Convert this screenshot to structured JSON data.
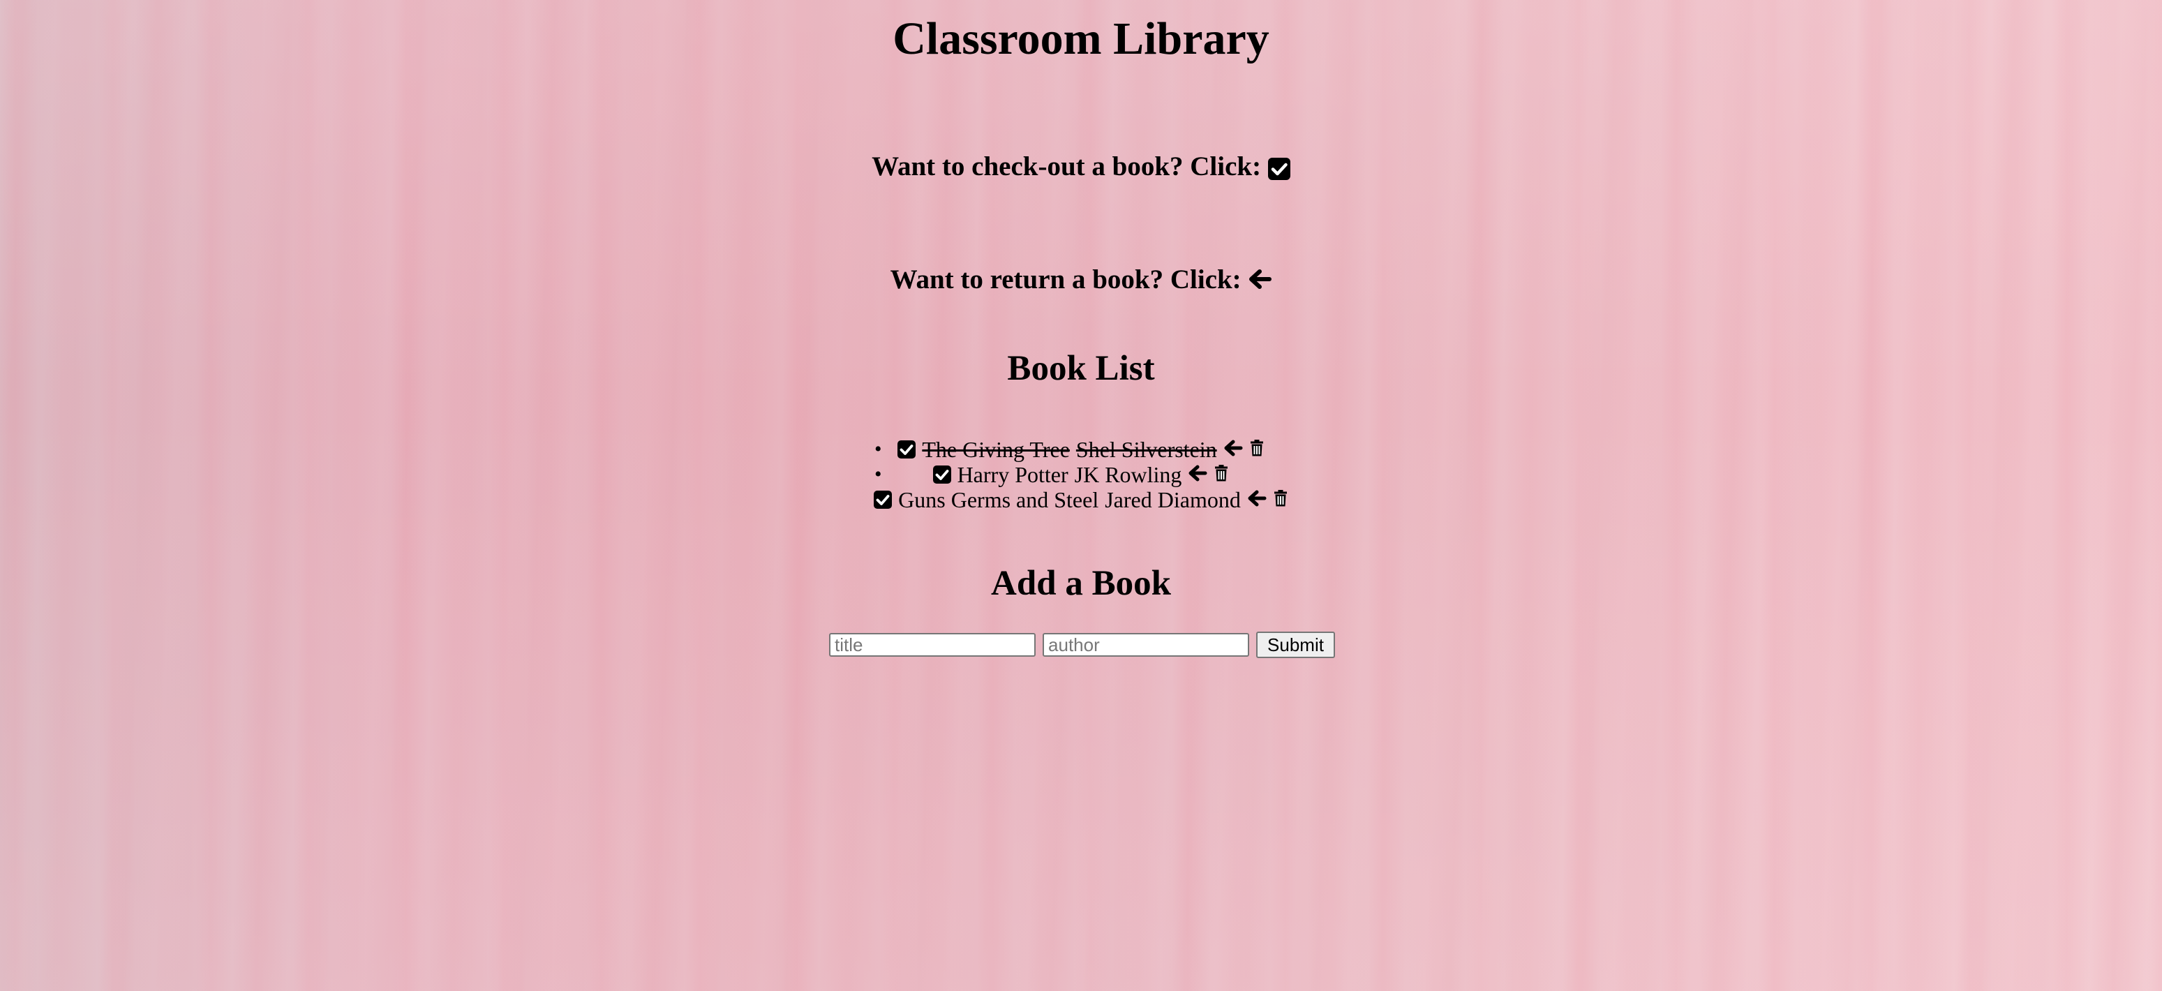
{
  "page": {
    "title": "Classroom Library",
    "checkout_instruction": "Want to check-out a book? Click:",
    "return_instruction": "Want to return a book? Click:",
    "book_list_heading": "Book List",
    "add_book_heading": "Add a Book"
  },
  "books": [
    {
      "title": "The Giving Tree",
      "author": "Shel Silverstein",
      "checked_out": true
    },
    {
      "title": "Harry Potter",
      "author": "JK Rowling",
      "checked_out": false
    },
    {
      "title": "Guns Germs and Steel",
      "author": "Jared Diamond",
      "checked_out": false
    }
  ],
  "form": {
    "title_placeholder": "title",
    "author_placeholder": "author",
    "submit_label": "Submit"
  },
  "icons": {
    "checkout": "check-square-icon",
    "return": "arrow-left-icon",
    "delete": "trash-icon"
  },
  "colors": {
    "background": "#e8b6bf",
    "text": "#000000"
  }
}
